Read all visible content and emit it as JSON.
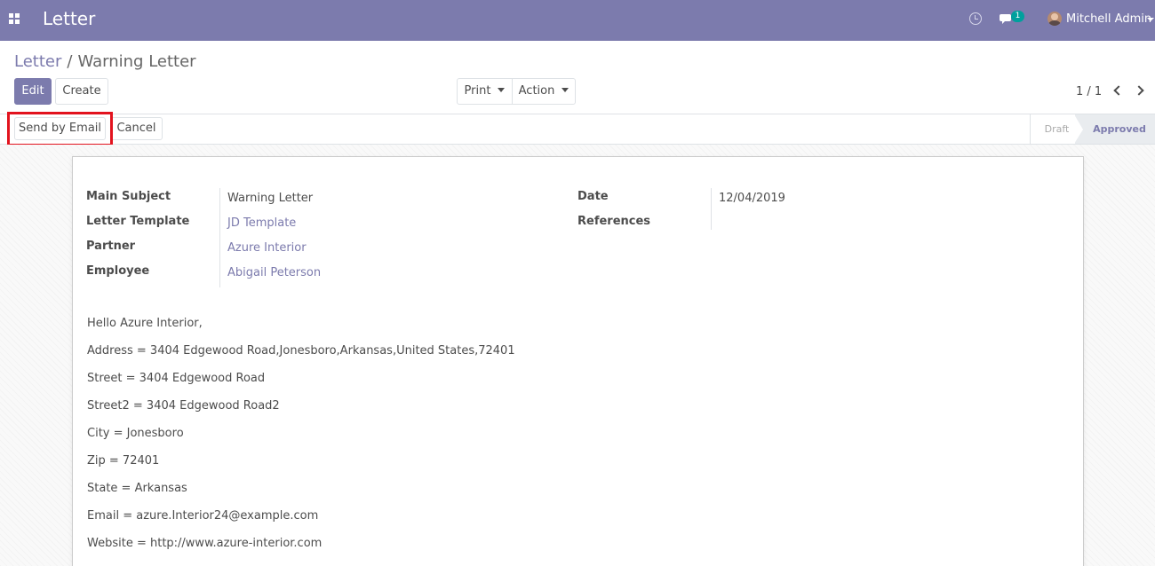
{
  "navbar": {
    "app_title": "Letter",
    "messages_count": "1",
    "user_name": "Mitchell Admin"
  },
  "breadcrumb": {
    "parent": "Letter",
    "current": "Warning Letter"
  },
  "buttons": {
    "edit": "Edit",
    "create": "Create",
    "print": "Print",
    "action": "Action",
    "send_by_email": "Send by Email",
    "cancel": "Cancel"
  },
  "pager": {
    "value": "1 / 1"
  },
  "stages": {
    "draft": "Draft",
    "approved": "Approved",
    "current": "Approved"
  },
  "form": {
    "left_fields": [
      {
        "label": "Main Subject",
        "value": "Warning Letter"
      },
      {
        "label": "Letter Template",
        "value": "JD Template"
      },
      {
        "label": "Partner",
        "value": "Azure Interior"
      },
      {
        "label": "Employee",
        "value": "Abigail Peterson"
      }
    ],
    "right_fields": [
      {
        "label": "Date",
        "value": "12/04/2019"
      },
      {
        "label": "References",
        "value": ""
      }
    ],
    "body_lines": [
      "Hello Azure Interior,",
      "Address = 3404 Edgewood Road,Jonesboro,Arkansas,United States,72401",
      "Street = 3404 Edgewood Road",
      "Street2 = 3404 Edgewood Road2",
      "City = Jonesboro",
      "Zip = 72401",
      "State = Arkansas",
      "Email = azure.Interior24@example.com",
      "Website = http://www.azure-interior.com"
    ]
  },
  "colors": {
    "brand": "#7c7bad",
    "highlight": "#e2131e",
    "badge": "#00a09d"
  }
}
